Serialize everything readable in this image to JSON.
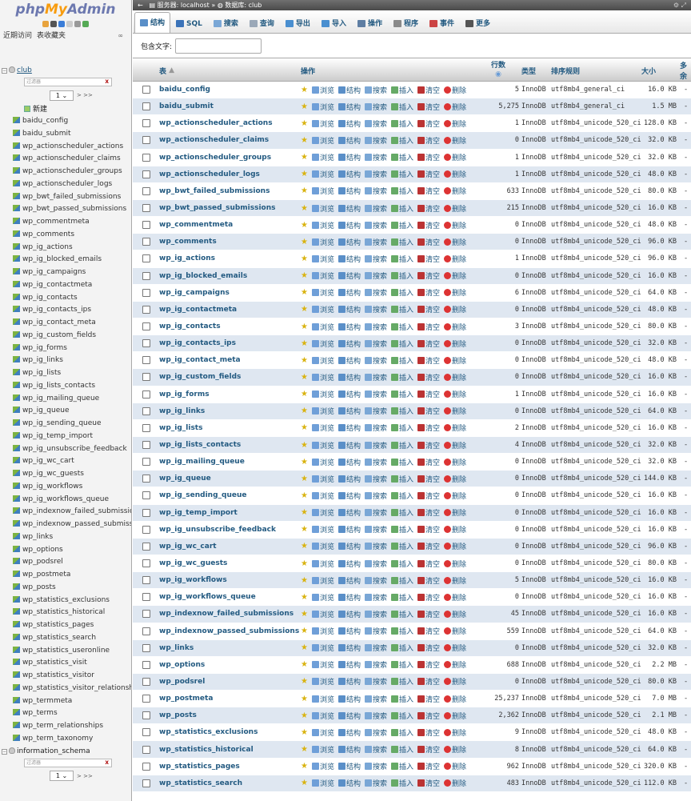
{
  "app": {
    "logo_a": "php",
    "logo_b": "My",
    "logo_c": "Admin"
  },
  "sidebar": {
    "recent": "近期访问",
    "favorites": "表收藏夹",
    "db_club": "club",
    "filter_placeholder": "过滤器",
    "page_value": "1",
    "next": "> >>",
    "new_label": "新建",
    "db_info": "information_schema",
    "tables": [
      "baidu_config",
      "baidu_submit",
      "wp_actionscheduler_actions",
      "wp_actionscheduler_claims",
      "wp_actionscheduler_groups",
      "wp_actionscheduler_logs",
      "wp_bwt_failed_submissions",
      "wp_bwt_passed_submissions",
      "wp_commentmeta",
      "wp_comments",
      "wp_ig_actions",
      "wp_ig_blocked_emails",
      "wp_ig_campaigns",
      "wp_ig_contactmeta",
      "wp_ig_contacts",
      "wp_ig_contacts_ips",
      "wp_ig_contact_meta",
      "wp_ig_custom_fields",
      "wp_ig_forms",
      "wp_ig_links",
      "wp_ig_lists",
      "wp_ig_lists_contacts",
      "wp_ig_mailing_queue",
      "wp_ig_queue",
      "wp_ig_sending_queue",
      "wp_ig_temp_import",
      "wp_ig_unsubscribe_feedback",
      "wp_ig_wc_cart",
      "wp_ig_wc_guests",
      "wp_ig_workflows",
      "wp_ig_workflows_queue",
      "wp_indexnow_failed_submissions",
      "wp_indexnow_passed_submissions",
      "wp_links",
      "wp_options",
      "wp_podsrel",
      "wp_postmeta",
      "wp_posts",
      "wp_statistics_exclusions",
      "wp_statistics_historical",
      "wp_statistics_pages",
      "wp_statistics_search",
      "wp_statistics_useronline",
      "wp_statistics_visit",
      "wp_statistics_visitor",
      "wp_statistics_visitor_relationships",
      "wp_termmeta",
      "wp_terms",
      "wp_term_relationships",
      "wp_term_taxonomy"
    ]
  },
  "breadcrumb": {
    "server": "服务器: localhost",
    "sep": "»",
    "db": "数据库: club"
  },
  "tabs": [
    {
      "label": "结构",
      "color": "#5a8fc8"
    },
    {
      "label": "SQL",
      "color": "#3b73b9"
    },
    {
      "label": "搜索",
      "color": "#7aa7d6"
    },
    {
      "label": "查询",
      "color": "#9aa8b8"
    },
    {
      "label": "导出",
      "color": "#4a8fd0"
    },
    {
      "label": "导入",
      "color": "#4a8fd0"
    },
    {
      "label": "操作",
      "color": "#5e7ea3"
    },
    {
      "label": "程序",
      "color": "#8a8a8a"
    },
    {
      "label": "事件",
      "color": "#c44"
    },
    {
      "label": "更多",
      "color": "#555"
    }
  ],
  "filter_label": "包含文字:",
  "headers": {
    "table": "表",
    "action": "操作",
    "rows": "行数",
    "type": "类型",
    "collation": "排序规则",
    "size": "大小",
    "overhead": "多余"
  },
  "action_labels": {
    "browse": "浏览",
    "structure": "结构",
    "search": "搜索",
    "insert": "插入",
    "empty": "清空",
    "drop": "删除"
  },
  "rows": [
    {
      "name": "baidu_config",
      "rows": "5",
      "type": "InnoDB",
      "coll": "utf8mb4_general_ci",
      "size": "16.0 KB",
      "over": "-"
    },
    {
      "name": "baidu_submit",
      "rows": "5,275",
      "type": "InnoDB",
      "coll": "utf8mb4_general_ci",
      "size": "1.5 MB",
      "over": "-"
    },
    {
      "name": "wp_actionscheduler_actions",
      "rows": "1",
      "type": "InnoDB",
      "coll": "utf8mb4_unicode_520_ci",
      "size": "128.0 KB",
      "over": "-"
    },
    {
      "name": "wp_actionscheduler_claims",
      "rows": "0",
      "type": "InnoDB",
      "coll": "utf8mb4_unicode_520_ci",
      "size": "32.0 KB",
      "over": "-"
    },
    {
      "name": "wp_actionscheduler_groups",
      "rows": "1",
      "type": "InnoDB",
      "coll": "utf8mb4_unicode_520_ci",
      "size": "32.0 KB",
      "over": "-"
    },
    {
      "name": "wp_actionscheduler_logs",
      "rows": "1",
      "type": "InnoDB",
      "coll": "utf8mb4_unicode_520_ci",
      "size": "48.0 KB",
      "over": "-"
    },
    {
      "name": "wp_bwt_failed_submissions",
      "rows": "633",
      "type": "InnoDB",
      "coll": "utf8mb4_unicode_520_ci",
      "size": "80.0 KB",
      "over": "-"
    },
    {
      "name": "wp_bwt_passed_submissions",
      "rows": "215",
      "type": "InnoDB",
      "coll": "utf8mb4_unicode_520_ci",
      "size": "16.0 KB",
      "over": "-"
    },
    {
      "name": "wp_commentmeta",
      "rows": "0",
      "type": "InnoDB",
      "coll": "utf8mb4_unicode_520_ci",
      "size": "48.0 KB",
      "over": "-"
    },
    {
      "name": "wp_comments",
      "rows": "0",
      "type": "InnoDB",
      "coll": "utf8mb4_unicode_520_ci",
      "size": "96.0 KB",
      "over": "-"
    },
    {
      "name": "wp_ig_actions",
      "rows": "1",
      "type": "InnoDB",
      "coll": "utf8mb4_unicode_520_ci",
      "size": "96.0 KB",
      "over": "-"
    },
    {
      "name": "wp_ig_blocked_emails",
      "rows": "0",
      "type": "InnoDB",
      "coll": "utf8mb4_unicode_520_ci",
      "size": "16.0 KB",
      "over": "-"
    },
    {
      "name": "wp_ig_campaigns",
      "rows": "6",
      "type": "InnoDB",
      "coll": "utf8mb4_unicode_520_ci",
      "size": "64.0 KB",
      "over": "-"
    },
    {
      "name": "wp_ig_contactmeta",
      "rows": "0",
      "type": "InnoDB",
      "coll": "utf8mb4_unicode_520_ci",
      "size": "48.0 KB",
      "over": "-"
    },
    {
      "name": "wp_ig_contacts",
      "rows": "3",
      "type": "InnoDB",
      "coll": "utf8mb4_unicode_520_ci",
      "size": "80.0 KB",
      "over": "-"
    },
    {
      "name": "wp_ig_contacts_ips",
      "rows": "0",
      "type": "InnoDB",
      "coll": "utf8mb4_unicode_520_ci",
      "size": "32.0 KB",
      "over": "-"
    },
    {
      "name": "wp_ig_contact_meta",
      "rows": "0",
      "type": "InnoDB",
      "coll": "utf8mb4_unicode_520_ci",
      "size": "48.0 KB",
      "over": "-"
    },
    {
      "name": "wp_ig_custom_fields",
      "rows": "0",
      "type": "InnoDB",
      "coll": "utf8mb4_unicode_520_ci",
      "size": "16.0 KB",
      "over": "-"
    },
    {
      "name": "wp_ig_forms",
      "rows": "1",
      "type": "InnoDB",
      "coll": "utf8mb4_unicode_520_ci",
      "size": "16.0 KB",
      "over": "-"
    },
    {
      "name": "wp_ig_links",
      "rows": "0",
      "type": "InnoDB",
      "coll": "utf8mb4_unicode_520_ci",
      "size": "64.0 KB",
      "over": "-"
    },
    {
      "name": "wp_ig_lists",
      "rows": "2",
      "type": "InnoDB",
      "coll": "utf8mb4_unicode_520_ci",
      "size": "16.0 KB",
      "over": "-"
    },
    {
      "name": "wp_ig_lists_contacts",
      "rows": "4",
      "type": "InnoDB",
      "coll": "utf8mb4_unicode_520_ci",
      "size": "32.0 KB",
      "over": "-"
    },
    {
      "name": "wp_ig_mailing_queue",
      "rows": "0",
      "type": "InnoDB",
      "coll": "utf8mb4_unicode_520_ci",
      "size": "32.0 KB",
      "over": "-"
    },
    {
      "name": "wp_ig_queue",
      "rows": "0",
      "type": "InnoDB",
      "coll": "utf8mb4_unicode_520_ci",
      "size": "144.0 KB",
      "over": "-"
    },
    {
      "name": "wp_ig_sending_queue",
      "rows": "0",
      "type": "InnoDB",
      "coll": "utf8mb4_unicode_520_ci",
      "size": "16.0 KB",
      "over": "-"
    },
    {
      "name": "wp_ig_temp_import",
      "rows": "0",
      "type": "InnoDB",
      "coll": "utf8mb4_unicode_520_ci",
      "size": "16.0 KB",
      "over": "-"
    },
    {
      "name": "wp_ig_unsubscribe_feedback",
      "rows": "0",
      "type": "InnoDB",
      "coll": "utf8mb4_unicode_520_ci",
      "size": "16.0 KB",
      "over": "-"
    },
    {
      "name": "wp_ig_wc_cart",
      "rows": "0",
      "type": "InnoDB",
      "coll": "utf8mb4_unicode_520_ci",
      "size": "96.0 KB",
      "over": "-"
    },
    {
      "name": "wp_ig_wc_guests",
      "rows": "0",
      "type": "InnoDB",
      "coll": "utf8mb4_unicode_520_ci",
      "size": "80.0 KB",
      "over": "-"
    },
    {
      "name": "wp_ig_workflows",
      "rows": "5",
      "type": "InnoDB",
      "coll": "utf8mb4_unicode_520_ci",
      "size": "16.0 KB",
      "over": "-"
    },
    {
      "name": "wp_ig_workflows_queue",
      "rows": "0",
      "type": "InnoDB",
      "coll": "utf8mb4_unicode_520_ci",
      "size": "16.0 KB",
      "over": "-"
    },
    {
      "name": "wp_indexnow_failed_submissions",
      "rows": "45",
      "type": "InnoDB",
      "coll": "utf8mb4_unicode_520_ci",
      "size": "16.0 KB",
      "over": "-"
    },
    {
      "name": "wp_indexnow_passed_submissions",
      "rows": "559",
      "type": "InnoDB",
      "coll": "utf8mb4_unicode_520_ci",
      "size": "64.0 KB",
      "over": "-"
    },
    {
      "name": "wp_links",
      "rows": "0",
      "type": "InnoDB",
      "coll": "utf8mb4_unicode_520_ci",
      "size": "32.0 KB",
      "over": "-"
    },
    {
      "name": "wp_options",
      "rows": "688",
      "type": "InnoDB",
      "coll": "utf8mb4_unicode_520_ci",
      "size": "2.2 MB",
      "over": "-"
    },
    {
      "name": "wp_podsrel",
      "rows": "0",
      "type": "InnoDB",
      "coll": "utf8mb4_unicode_520_ci",
      "size": "80.0 KB",
      "over": "-"
    },
    {
      "name": "wp_postmeta",
      "rows": "25,237",
      "type": "InnoDB",
      "coll": "utf8mb4_unicode_520_ci",
      "size": "7.0 MB",
      "over": "-"
    },
    {
      "name": "wp_posts",
      "rows": "2,362",
      "type": "InnoDB",
      "coll": "utf8mb4_unicode_520_ci",
      "size": "2.1 MB",
      "over": "-"
    },
    {
      "name": "wp_statistics_exclusions",
      "rows": "9",
      "type": "InnoDB",
      "coll": "utf8mb4_unicode_520_ci",
      "size": "48.0 KB",
      "over": "-"
    },
    {
      "name": "wp_statistics_historical",
      "rows": "8",
      "type": "InnoDB",
      "coll": "utf8mb4_unicode_520_ci",
      "size": "64.0 KB",
      "over": "-"
    },
    {
      "name": "wp_statistics_pages",
      "rows": "962",
      "type": "InnoDB",
      "coll": "utf8mb4_unicode_520_ci",
      "size": "320.0 KB",
      "over": "-"
    },
    {
      "name": "wp_statistics_search",
      "rows": "483",
      "type": "InnoDB",
      "coll": "utf8mb4_unicode_520_ci",
      "size": "112.0 KB",
      "over": "-"
    }
  ]
}
